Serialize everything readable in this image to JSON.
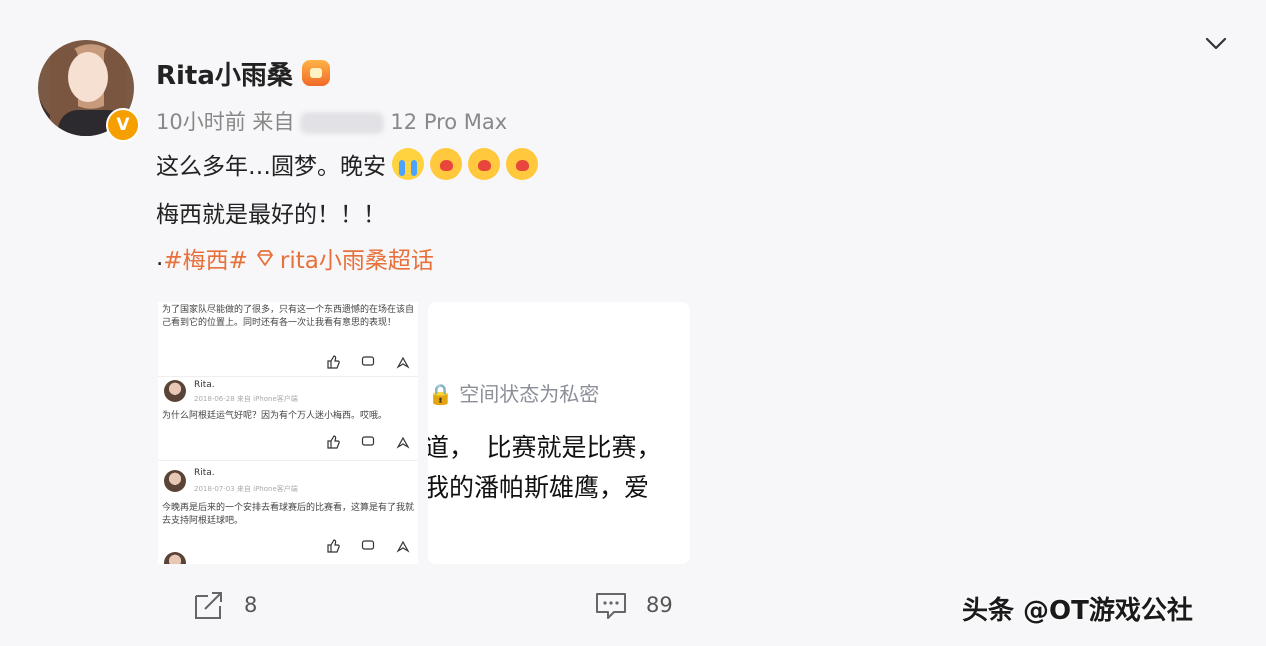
{
  "post": {
    "username": "Rita小雨桑",
    "time": "10小时前",
    "source_prefix": "来自",
    "device": "12 Pro Max",
    "line1": "这么多年…圆梦。晚安",
    "line2": "梅西就是最好的！！！",
    "line3_dot": ".",
    "hashtag": "#梅西#",
    "supertopic": "rita小雨桑超话",
    "emojis": [
      "crying-face",
      "kiss-face",
      "kiss-face",
      "kiss-face"
    ]
  },
  "image1": {
    "block1_text": "为了国家队尽能做的了很多，只有这一个东西遗憾的在场在该自己看到它的位置上。同时还有各一次让我看有意思的表现！",
    "c1_name": "Rita.",
    "c1_time": "2018-06-28 来自 iPhone客户端",
    "c1_text": "为什么阿根廷运气好呢？因为有个万人迷小梅西。哎哦。",
    "c2_name": "Rita.",
    "c2_time": "2018-07-03 来自 iPhone客户端",
    "c2_text": "今晚再是后来的一个安排去看球赛后的比赛看，这算是有了我就去支持阿根廷球吧。"
  },
  "image2": {
    "private_label": "空间状态为私密",
    "line_a": "道，　比赛就是比赛，",
    "line_b": "我的潘帕斯雄鹰，爱"
  },
  "footer": {
    "repost_count": "8",
    "comment_count": "89",
    "watermark": "头条 @OT游戏公社"
  },
  "colors": {
    "tag": "#e8703a",
    "meta": "#888888",
    "badge": "#f5a000"
  }
}
